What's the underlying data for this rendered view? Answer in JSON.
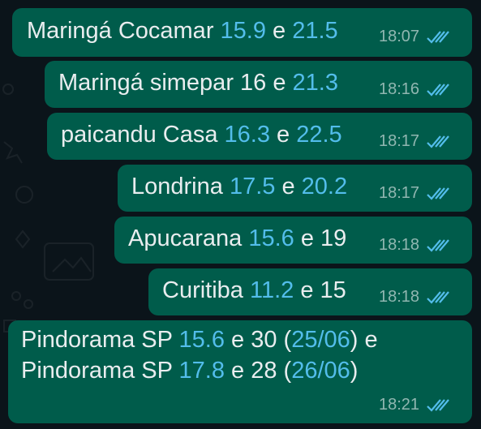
{
  "colors": {
    "background": "#0b141a",
    "bubble_outgoing": "#005c4b",
    "text": "#e9edef",
    "number_highlight": "#53bdeb",
    "read_ticks": "#53bdeb"
  },
  "icons": {
    "read_receipt": "double-check-icon"
  },
  "messages": [
    {
      "segments": [
        {
          "text": "Maringá Cocamar ",
          "type": "text"
        },
        {
          "text": "15.9",
          "type": "num"
        },
        {
          "text": " e ",
          "type": "text"
        },
        {
          "text": "21.5",
          "type": "num"
        }
      ],
      "time": "18:07",
      "status": "read"
    },
    {
      "segments": [
        {
          "text": "Maringá simepar 16 e ",
          "type": "text"
        },
        {
          "text": "21.3",
          "type": "num"
        }
      ],
      "time": "18:16",
      "status": "read"
    },
    {
      "segments": [
        {
          "text": "paicandu Casa ",
          "type": "text"
        },
        {
          "text": "16.3",
          "type": "num"
        },
        {
          "text": " e ",
          "type": "text"
        },
        {
          "text": "22.5",
          "type": "num"
        }
      ],
      "time": "18:17",
      "status": "read"
    },
    {
      "segments": [
        {
          "text": "Londrina ",
          "type": "text"
        },
        {
          "text": "17.5",
          "type": "num"
        },
        {
          "text": " e ",
          "type": "text"
        },
        {
          "text": "20.2",
          "type": "num"
        }
      ],
      "time": "18:17",
      "status": "read"
    },
    {
      "segments": [
        {
          "text": "Apucarana ",
          "type": "text"
        },
        {
          "text": "15.6",
          "type": "num"
        },
        {
          "text": " e 19",
          "type": "text"
        }
      ],
      "time": "18:18",
      "status": "read"
    },
    {
      "segments": [
        {
          "text": "Curitiba ",
          "type": "text"
        },
        {
          "text": "11.2",
          "type": "num"
        },
        {
          "text": " e 15",
          "type": "text"
        }
      ],
      "time": "18:18",
      "status": "read"
    },
    {
      "lines": [
        [
          {
            "text": "Pindorama SP ",
            "type": "text"
          },
          {
            "text": "15.6",
            "type": "num"
          },
          {
            "text": " e 30 (",
            "type": "text"
          },
          {
            "text": "25/06",
            "type": "num"
          },
          {
            "text": ") e",
            "type": "text"
          }
        ],
        [
          {
            "text": "Pindorama SP ",
            "type": "text"
          },
          {
            "text": "17.8",
            "type": "num"
          },
          {
            "text": " e 28 (",
            "type": "text"
          },
          {
            "text": "26/06",
            "type": "num"
          },
          {
            "text": ")",
            "type": "text"
          }
        ]
      ],
      "time": "18:21",
      "status": "read"
    }
  ]
}
